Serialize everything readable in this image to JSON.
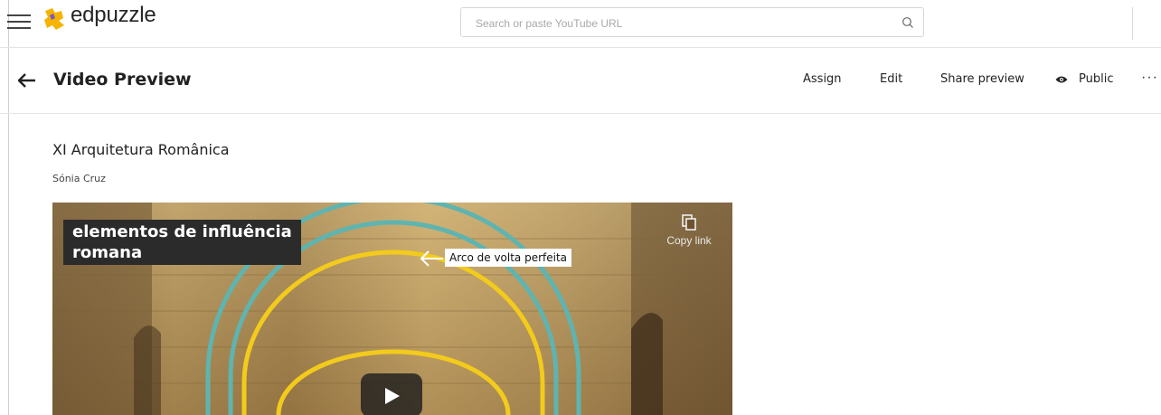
{
  "app": {
    "name": "edpuzzle",
    "brand_color": "#f6b400"
  },
  "search": {
    "placeholder": "Search or paste YouTube URL",
    "value": ""
  },
  "header": {
    "title": "Video Preview",
    "actions": [
      {
        "label": "Assign"
      },
      {
        "label": "Edit"
      },
      {
        "label": "Share preview"
      },
      {
        "label": "Public",
        "icon": "eye-icon"
      }
    ],
    "more_label": "···"
  },
  "video": {
    "title": "XI Arquitetura Românica",
    "author": "Sónia Cruz",
    "caption_line1": "elementos de influência",
    "caption_line2": "romana",
    "annotation": "Arco de volta perfeita",
    "copy_link_label": "Copy link",
    "arc_colors": {
      "outer": "#5fb4b0",
      "inner": "#f2cb1d"
    }
  }
}
